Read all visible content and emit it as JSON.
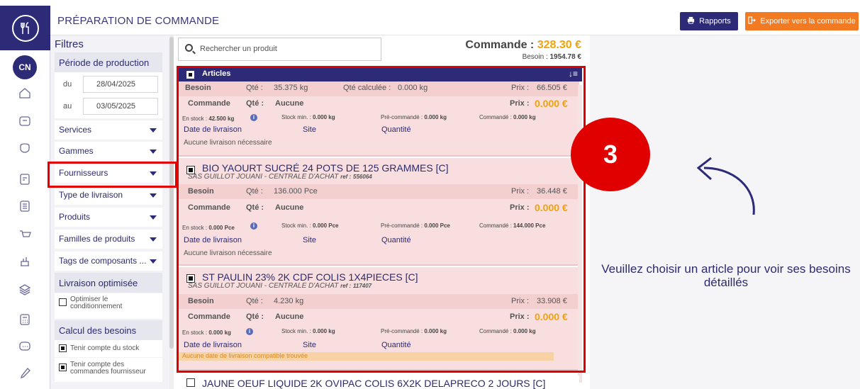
{
  "header": {
    "title": "PRÉPARATION DE COMMANDE",
    "rapports_label": "Rapports",
    "export_label": "Exporter vers la commande"
  },
  "sidebar": {
    "avatar_initials": "CN",
    "icons": [
      "home-icon",
      "box-icon",
      "tag-icon",
      "document-list-icon",
      "receipt-icon",
      "cart-icon",
      "factory-icon",
      "layers-icon",
      "calculator-icon",
      "chat-icon",
      "flask-icon"
    ]
  },
  "filters": {
    "title": "Filtres",
    "periode_label": "Période de production",
    "du_label": "du",
    "du_value": "28/04/2025",
    "au_label": "au",
    "au_value": "03/05/2025",
    "items": [
      {
        "label": "Services"
      },
      {
        "label": "Gammes"
      },
      {
        "label": "Fournisseurs"
      },
      {
        "label": "Type de livraison"
      },
      {
        "label": "Produits"
      },
      {
        "label": "Familles de produits"
      },
      {
        "label": "Tags de composants ..."
      }
    ],
    "livraison_title": "Livraison optimisée",
    "optimiser_label": "Optimiser le conditionnement",
    "calcul_title": "Calcul des besoins",
    "stock_label": "Tenir compte du stock",
    "cmd_fourn_label": "Tenir compte des commandes fournisseur"
  },
  "search": {
    "placeholder": "Rechercher un produit"
  },
  "totals": {
    "commande_label": "Commande :",
    "commande_value": "328.30 €",
    "besoin_label": "Besoin :",
    "besoin_value": "1954.78 €"
  },
  "list": {
    "header_label": "Articles",
    "labels": {
      "besoin": "Besoin",
      "qte": "Qté :",
      "qte_calc": "Qté calculée :",
      "commande": "Commande",
      "aucune": "Aucune",
      "prix": "Prix :",
      "en_stock": "En stock :",
      "stock_min": "Stock min. :",
      "pre_commande": "Pré-commandé :",
      "commande_small": "Commandé :",
      "date_livraison": "Date de livraison",
      "site": "Site",
      "quantite": "Quantité",
      "ref": "ref :"
    },
    "items": [
      {
        "name": "",
        "supplier": "",
        "ref": "",
        "besoin_qte": "35.375 kg",
        "qte_calculee": "0.000 kg",
        "prix_besoin": "66.505 €",
        "prix_commande": "0.000 €",
        "en_stock": "42.500 kg",
        "stock_min": "0.000 kg",
        "pre_commande": "0.000 kg",
        "commande": "0.000 kg",
        "livraison_note": "Aucune livraison nécessaire"
      },
      {
        "name": "BIO YAOURT SUCRÉ 24 POTS DE 125 GRAMMES [C]",
        "supplier": "SAS GUILLOT JOUANI - CENTRALE D'ACHAT",
        "ref": "556064",
        "besoin_qte": "136.000 Pce",
        "prix_besoin": "36.448 €",
        "prix_commande": "0.000 €",
        "en_stock": "0.000 Pce",
        "stock_min": "0.000 Pce",
        "pre_commande": "0.000 Pce",
        "commande": "144.000 Pce",
        "livraison_note": "Aucune livraison nécessaire"
      },
      {
        "name": "ST PAULIN 23% 2K CDF COLIS 1X4PIECES [C]",
        "supplier": "SAS GUILLOT JOUANI - CENTRALE D'ACHAT",
        "ref": "117407",
        "besoin_qte": "4.230 kg",
        "prix_besoin": "33.908 €",
        "prix_commande": "0.000 €",
        "en_stock": "0.000 kg",
        "stock_min": "0.000 kg",
        "pre_commande": "0.000 kg",
        "commande": "0.000 kg",
        "livraison_note": "Aucune date de livraison compatible trouvée"
      }
    ],
    "next_item_partial": "JAUNE OEUF LIQUIDE 2K OVIPAC COLIS 6X2K DELAPRECO 2 JOURS [C]"
  },
  "annotation": {
    "step_number": "3"
  },
  "right_panel": {
    "message": "Veuillez choisir un article pour voir ses besoins détaillés"
  },
  "colors": {
    "navy": "#2d2a78",
    "orange": "#f27a22",
    "price_orange": "#f2a20a",
    "card_bg": "#f8dede",
    "highlight_red": "#e00000"
  }
}
